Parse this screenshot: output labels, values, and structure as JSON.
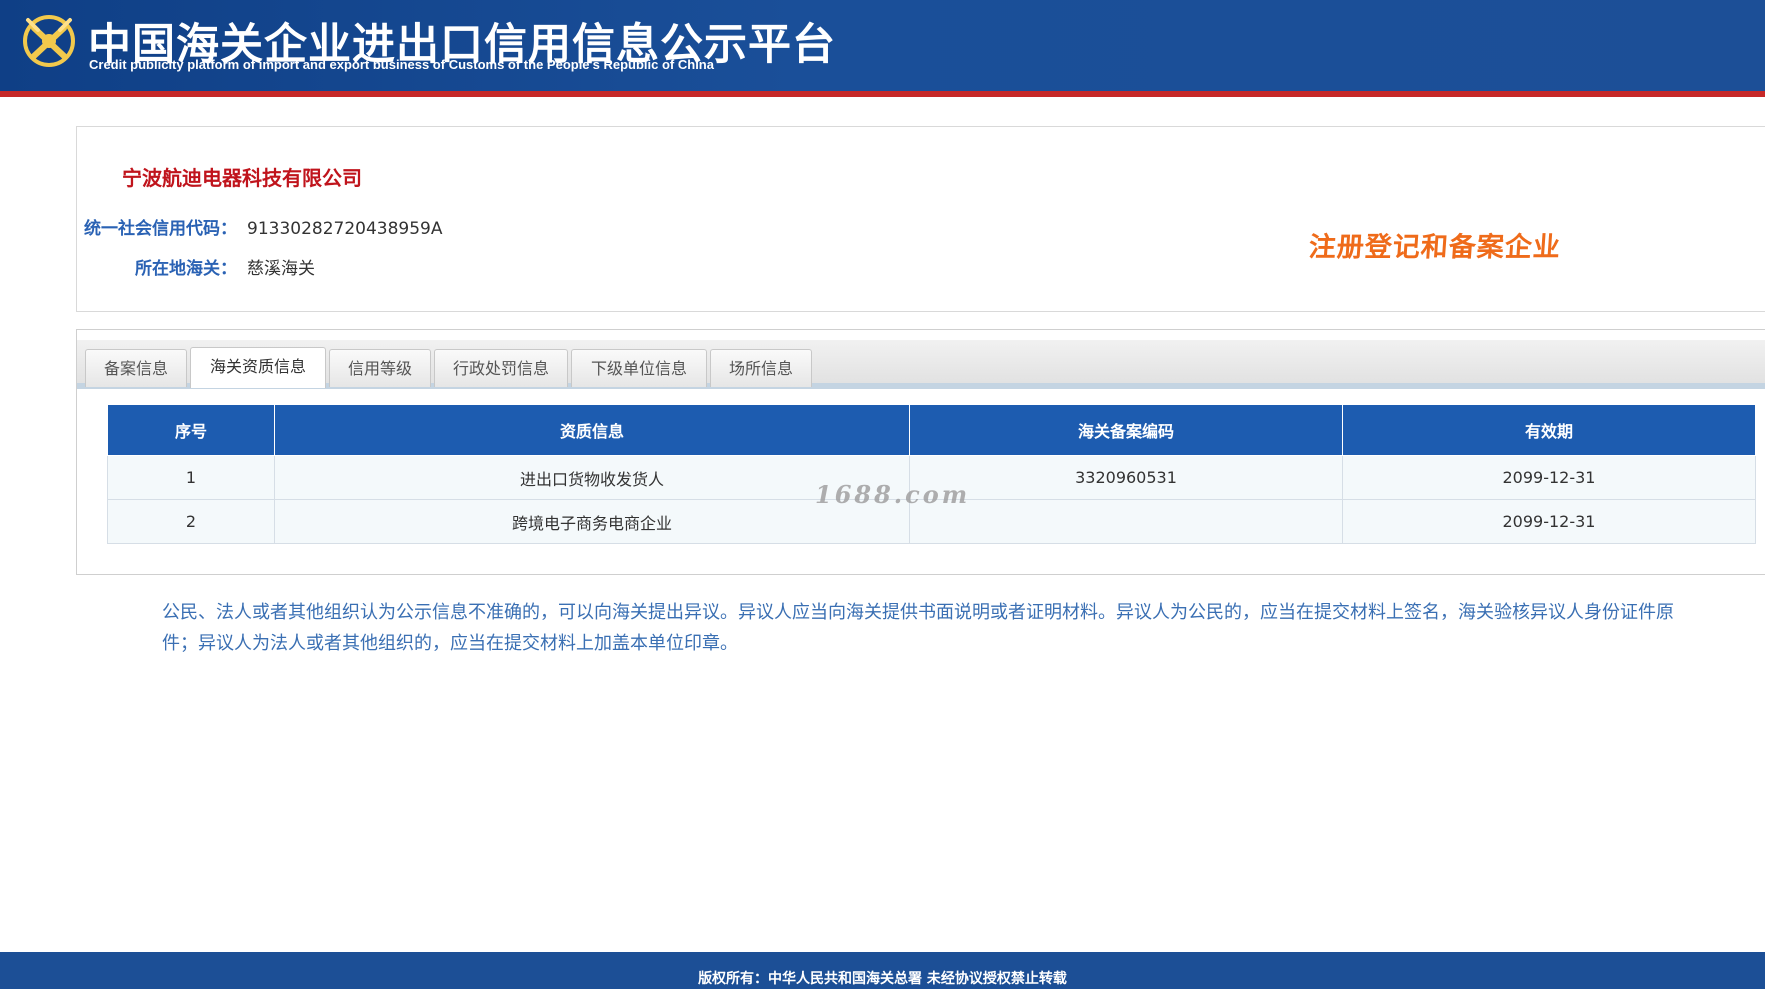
{
  "header": {
    "title": "中国海关企业进出口信用信息公示平台",
    "subtitle": "Credit publicity platform of import and export business of Customs of the People's Republic of China",
    "logo_icon": "customs-emblem-icon"
  },
  "company": {
    "name": "宁波航迪电器科技有限公司",
    "credit_code_label": "统一社会信用代码：",
    "credit_code": "91330282720438959A",
    "customs_label": "所在地海关：",
    "customs": "慈溪海关",
    "status_stamp": "注册登记和备案企业"
  },
  "tabs": [
    {
      "label": "备案信息",
      "active": false
    },
    {
      "label": "海关资质信息",
      "active": true
    },
    {
      "label": "信用等级",
      "active": false
    },
    {
      "label": "行政处罚信息",
      "active": false
    },
    {
      "label": "下级单位信息",
      "active": false
    },
    {
      "label": "场所信息",
      "active": false
    }
  ],
  "table": {
    "headers": [
      "序号",
      "资质信息",
      "海关备案编码",
      "有效期"
    ],
    "rows": [
      [
        "1",
        "进出口货物收发货人",
        "3320960531",
        "2099-12-31"
      ],
      [
        "2",
        "跨境电子商务电商企业",
        "",
        "2099-12-31"
      ]
    ]
  },
  "watermark": "1688.com",
  "notice": "公民、法人或者其他组织认为公示信息不准确的，可以向海关提出异议。异议人应当向海关提供书面说明或者证明材料。异议人为公民的，应当在提交材料上签名，海关验核异议人身份证件原件；异议人为法人或者其他组织的，应当在提交材料上加盖本单位印章。",
  "footer": {
    "text": "版权所有：中华人民共和国海关总署   未经协议授权禁止转载"
  },
  "colors": {
    "header_bg": "#1a4f99",
    "header_border": "#c62828",
    "company_name": "#c0141c",
    "label": "#2a62b4",
    "stamp": "#ef6b1a",
    "table_header": "#1d5cb0"
  }
}
